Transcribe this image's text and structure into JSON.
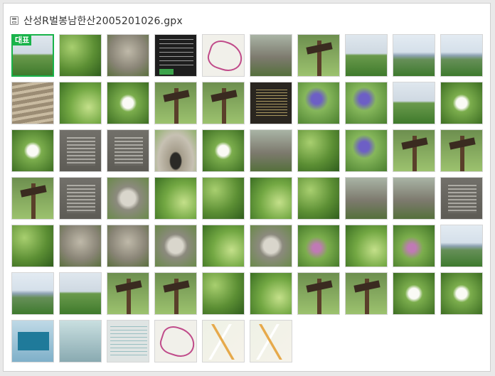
{
  "window": {
    "title": "산성R벌봉남한산2005201026.gpx",
    "icon": "save-icon"
  },
  "gallery": {
    "representative_badge": "대표",
    "selected_index": 0,
    "thumbnails": [
      {
        "kind": "sky-forest"
      },
      {
        "kind": "forest"
      },
      {
        "kind": "rock"
      },
      {
        "kind": "screen"
      },
      {
        "kind": "map"
      },
      {
        "kind": "wall"
      },
      {
        "kind": "sign"
      },
      {
        "kind": "sky-forest"
      },
      {
        "kind": "sky-mtn"
      },
      {
        "kind": "sky-mtn"
      },
      {
        "kind": "stairs"
      },
      {
        "kind": "forest2"
      },
      {
        "kind": "flower"
      },
      {
        "kind": "sign"
      },
      {
        "kind": "sign"
      },
      {
        "kind": "darkboard"
      },
      {
        "kind": "iris"
      },
      {
        "kind": "iris"
      },
      {
        "kind": "sky-forest"
      },
      {
        "kind": "flower"
      },
      {
        "kind": "flower"
      },
      {
        "kind": "board"
      },
      {
        "kind": "board"
      },
      {
        "kind": "gate"
      },
      {
        "kind": "flower"
      },
      {
        "kind": "wall"
      },
      {
        "kind": "forest"
      },
      {
        "kind": "iris"
      },
      {
        "kind": "sign"
      },
      {
        "kind": "sign"
      },
      {
        "kind": "sign"
      },
      {
        "kind": "board"
      },
      {
        "kind": "stone"
      },
      {
        "kind": "forest2"
      },
      {
        "kind": "forest"
      },
      {
        "kind": "forest2"
      },
      {
        "kind": "forest"
      },
      {
        "kind": "wall"
      },
      {
        "kind": "wall"
      },
      {
        "kind": "board"
      },
      {
        "kind": "forest"
      },
      {
        "kind": "rock"
      },
      {
        "kind": "rock"
      },
      {
        "kind": "stone"
      },
      {
        "kind": "forest2"
      },
      {
        "kind": "stone"
      },
      {
        "kind": "purple"
      },
      {
        "kind": "forest2"
      },
      {
        "kind": "purple"
      },
      {
        "kind": "sky-mtn"
      },
      {
        "kind": "sky-mtn"
      },
      {
        "kind": "sky-forest"
      },
      {
        "kind": "sign"
      },
      {
        "kind": "sign"
      },
      {
        "kind": "forest"
      },
      {
        "kind": "forest2"
      },
      {
        "kind": "sign"
      },
      {
        "kind": "sign"
      },
      {
        "kind": "flower"
      },
      {
        "kind": "flower"
      },
      {
        "kind": "bluesign"
      },
      {
        "kind": "snapshot"
      },
      {
        "kind": "paper"
      },
      {
        "kind": "map"
      },
      {
        "kind": "citymap"
      },
      {
        "kind": "citymap"
      }
    ]
  }
}
